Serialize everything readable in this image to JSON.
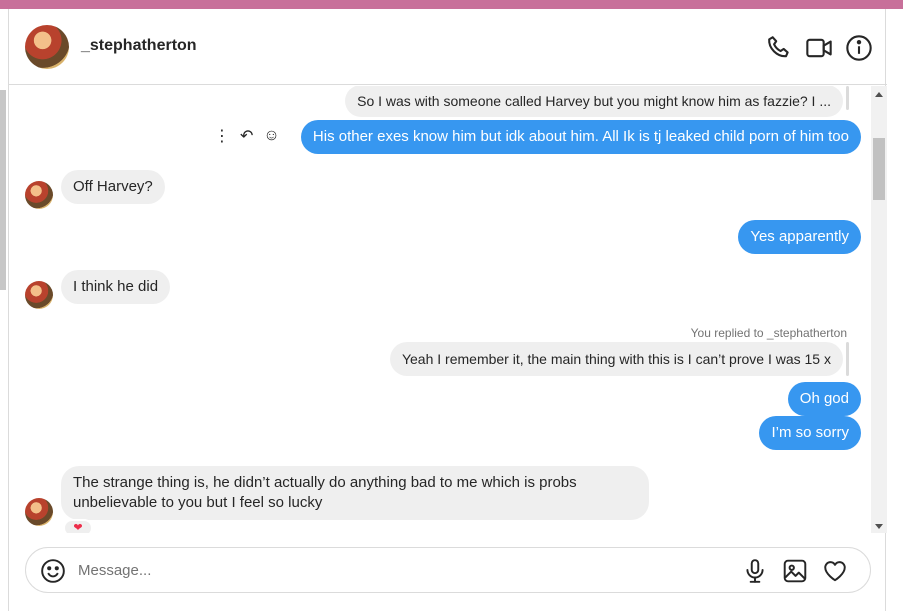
{
  "header": {
    "username": "_stephatherton"
  },
  "messages": {
    "m1": "So I was with someone called Harvey but you might know him as fazzie? I ...",
    "m2": "His other exes know him but idk about him. All Ik is tj leaked child porn of him too",
    "m3": "Off Harvey?",
    "m4": "Yes apparently",
    "m5": "I think he did",
    "reply_note": "You replied to _stephatherton",
    "m6": "Yeah I remember it, the main thing with this is I can’t prove I was 15 x",
    "m7": "Oh god",
    "m8": "I’m so sorry",
    "m9_line1": "The strange thing is, he didn’t actually do anything bad to me which is probs",
    "m9_line2": "unbelievable to you but I feel so lucky",
    "reaction": "❤"
  },
  "composer": {
    "placeholder": "Message..."
  },
  "icons": {
    "call": "phone-icon",
    "video": "video-camera-icon",
    "info": "info-icon",
    "emoji": "emoji-icon",
    "mic": "microphone-icon",
    "image": "image-icon",
    "like": "heart-icon",
    "more": "more-options-icon",
    "reply": "reply-icon",
    "react": "react-emoji-icon"
  },
  "colors": {
    "outgoing": "#3797f0",
    "incoming": "#efefef",
    "topbar": "#c8709a",
    "reaction": "#ed2d4a"
  }
}
